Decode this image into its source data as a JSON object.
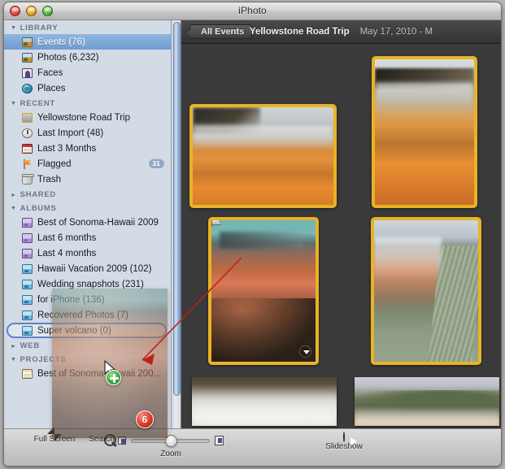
{
  "window": {
    "title": "iPhoto",
    "controls": [
      "close",
      "minimize",
      "zoom"
    ]
  },
  "sidebar": {
    "sections": [
      {
        "name": "LIBRARY",
        "expanded": true,
        "items": [
          {
            "label": "Events (76)",
            "icon": "events-icon",
            "selected": true
          },
          {
            "label": "Photos (6,232)",
            "icon": "photos-icon",
            "selected": false
          },
          {
            "label": "Faces",
            "icon": "faces-icon",
            "selected": false
          },
          {
            "label": "Places",
            "icon": "places-icon",
            "selected": false
          }
        ]
      },
      {
        "name": "RECENT",
        "expanded": true,
        "items": [
          {
            "label": "Yellowstone Road Trip",
            "icon": "event-thumb-icon",
            "selected": false
          },
          {
            "label": "Last Import (48)",
            "icon": "clock-icon",
            "selected": false
          },
          {
            "label": "Last 3 Months",
            "icon": "calendar-icon",
            "selected": false
          },
          {
            "label": "Flagged",
            "icon": "flag-icon",
            "selected": false,
            "badge": "31"
          },
          {
            "label": "Trash",
            "icon": "trash-icon",
            "selected": false
          }
        ]
      },
      {
        "name": "SHARED",
        "expanded": false,
        "items": []
      },
      {
        "name": "ALBUMS",
        "expanded": true,
        "items": [
          {
            "label": "Best of Sonoma-Hawaii 2009",
            "icon": "smart-album-icon",
            "selected": false
          },
          {
            "label": "Last 6 months",
            "icon": "smart-album-icon",
            "selected": false
          },
          {
            "label": "Last 4 months",
            "icon": "smart-album-icon",
            "selected": false
          },
          {
            "label": "Hawaii Vacation 2009 (102)",
            "icon": "album-icon",
            "selected": false
          },
          {
            "label": "Wedding snapshots (231)",
            "icon": "album-icon",
            "selected": false
          },
          {
            "label": "for iPhone (136)",
            "icon": "album-icon",
            "selected": false
          },
          {
            "label": "Recovered Photos (7)",
            "icon": "album-icon",
            "selected": false
          },
          {
            "label": "Super volcano (0)",
            "icon": "album-icon",
            "selected": false,
            "drop_target": true
          }
        ]
      },
      {
        "name": "WEB",
        "expanded": false,
        "items": []
      },
      {
        "name": "PROJECTS",
        "expanded": true,
        "items": [
          {
            "label": "Best of Sonoma-Hawaii 200...",
            "icon": "book-icon",
            "selected": false
          }
        ]
      }
    ]
  },
  "event_bar": {
    "back_button": "All Events",
    "event_name": "Yellowstone Road Trip",
    "event_date": "May 17, 2010 - M"
  },
  "grid": {
    "photos": [
      {
        "id": "photo-1",
        "selected": true,
        "flagged": false,
        "has_info_badge": false,
        "scene": "hot-spring-wide"
      },
      {
        "id": "photo-2",
        "selected": true,
        "flagged": false,
        "has_info_badge": false,
        "scene": "hot-spring-tall"
      },
      {
        "id": "photo-3",
        "selected": true,
        "flagged": true,
        "has_info_badge": true,
        "scene": "orange-pool"
      },
      {
        "id": "photo-4",
        "selected": true,
        "flagged": false,
        "has_info_badge": false,
        "scene": "boardwalk"
      },
      {
        "id": "photo-5",
        "selected": false,
        "flagged": false,
        "has_info_badge": false,
        "scene": "steam-trees"
      },
      {
        "id": "photo-6",
        "selected": false,
        "flagged": false,
        "has_info_badge": false,
        "scene": "ridge-steam"
      }
    ]
  },
  "drag": {
    "selected_count": "6",
    "drop_cursor": "copy",
    "plus_badge": "add-copy-badge"
  },
  "toolbar": {
    "full_screen": "Full Screen",
    "search": "Search",
    "zoom": "Zoom",
    "slideshow": "Slideshow"
  },
  "colors": {
    "selection_border": "#e8b326",
    "sidebar_selection": "#6f9cd0",
    "drop_ring": "#5b85c8",
    "badge_red": "#e03a28",
    "badge_green": "#3aa83c",
    "annotation_red": "#c0201c"
  }
}
